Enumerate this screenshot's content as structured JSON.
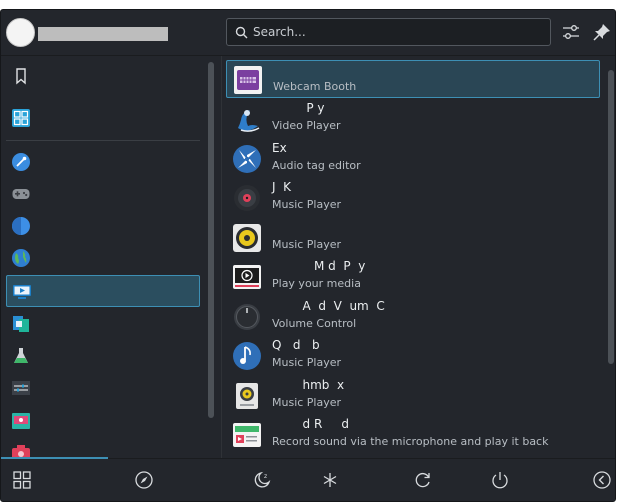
{
  "header": {
    "search_placeholder": "Search...",
    "icons": [
      "avatar",
      "search-icon",
      "settings-icon",
      "pin-icon"
    ]
  },
  "sidebar": {
    "items": [
      {
        "icon": "bookmark-icon",
        "selected": false
      },
      {
        "icon": "all-apps-icon",
        "selected": false
      },
      {
        "icon": "development-icon",
        "selected": false
      },
      {
        "icon": "games-icon",
        "selected": false
      },
      {
        "icon": "graphics-icon",
        "selected": false
      },
      {
        "icon": "internet-icon",
        "selected": false
      },
      {
        "icon": "multimedia-icon",
        "selected": true
      },
      {
        "icon": "office-icon",
        "selected": false
      },
      {
        "icon": "science-icon",
        "selected": false
      },
      {
        "icon": "settings-icon",
        "selected": false
      },
      {
        "icon": "system-icon",
        "selected": false
      },
      {
        "icon": "utilities-icon",
        "selected": false
      }
    ]
  },
  "apps": [
    {
      "name": "",
      "desc": "Webcam Booth",
      "icon": "webcam-booth-icon",
      "selected": true
    },
    {
      "name": "         P y",
      "desc": "Video Player",
      "icon": "video-player-icon"
    },
    {
      "name": "Ex",
      "desc": "Audio tag editor",
      "icon": "audio-tag-editor-icon"
    },
    {
      "name": "J  K",
      "desc": "Music Player",
      "icon": "music-player-disc-icon"
    },
    {
      "name": "",
      "desc": "Music Player",
      "icon": "music-player-speaker-icon"
    },
    {
      "name": "           M d  P  y",
      "desc": "Play your media",
      "icon": "media-player-icon"
    },
    {
      "name": "        A  d  V  um  C",
      "desc": "Volume Control",
      "icon": "volume-control-icon"
    },
    {
      "name": "Q   d   b",
      "desc": "Music Player",
      "icon": "music-note-icon"
    },
    {
      "name": "        hmb  x",
      "desc": "Music Player",
      "icon": "music-box-icon"
    },
    {
      "name": "        d R     d",
      "desc": "Record sound via the microphone and play it back",
      "icon": "sound-recorder-icon"
    }
  ],
  "footer": {
    "icons": [
      "applications-icon",
      "places-icon",
      "sleep-icon",
      "hibernate-icon",
      "restart-icon",
      "shutdown-icon",
      "back-icon"
    ]
  },
  "colors": {
    "panel": "#23262c",
    "accent": "#3d8fb4",
    "selection": "#2b4e5f"
  }
}
